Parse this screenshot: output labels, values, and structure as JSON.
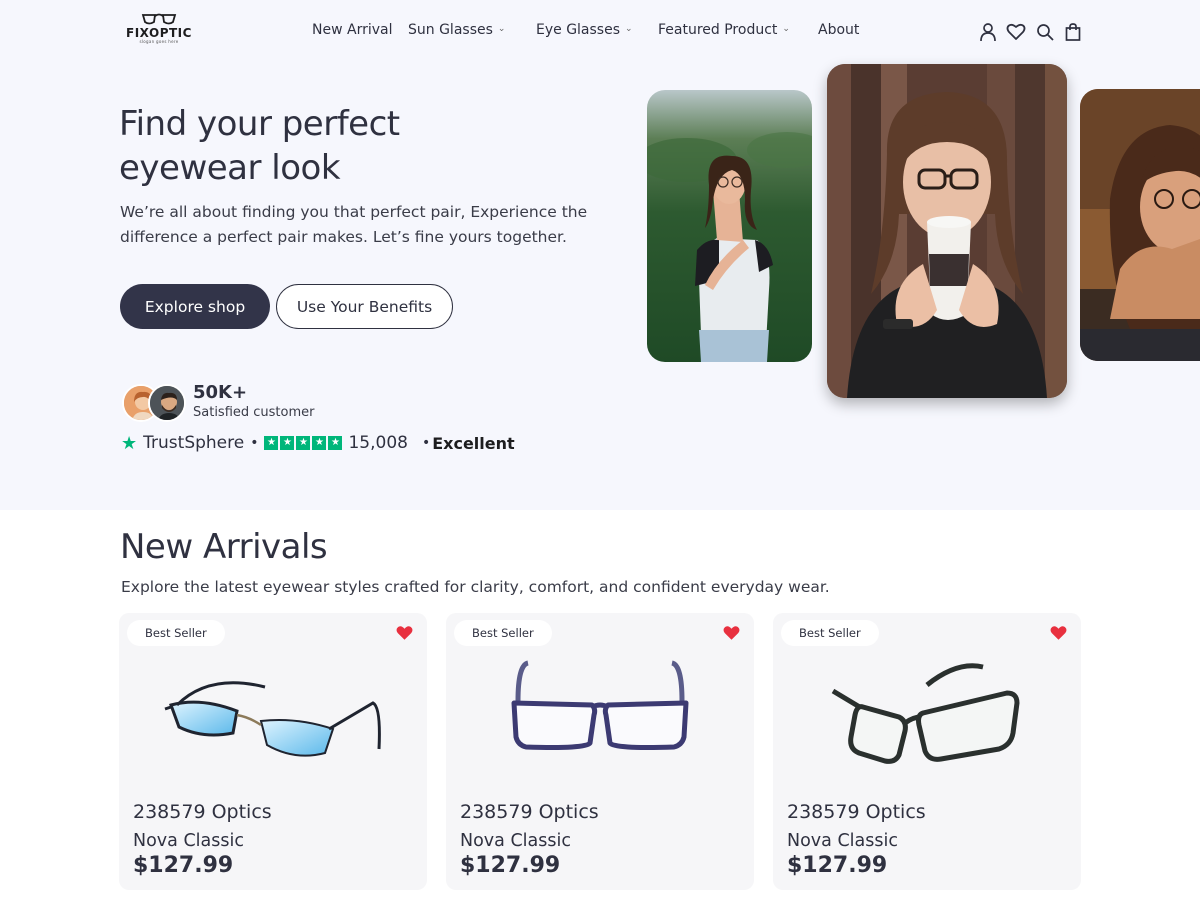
{
  "brand": {
    "name": "FIXOPTIC",
    "slogan": "slogan goes here"
  },
  "nav": {
    "items": [
      {
        "label": "New Arrival",
        "dropdown": false
      },
      {
        "label": "Sun Glasses",
        "dropdown": true
      },
      {
        "label": "Eye Glasses",
        "dropdown": true
      },
      {
        "label": "Featured Product",
        "dropdown": true
      },
      {
        "label": "About",
        "dropdown": false
      }
    ],
    "icons": [
      "user-icon",
      "heart-icon",
      "search-icon",
      "shopping-bag-icon"
    ]
  },
  "hero": {
    "title_line1": "Find your perfect",
    "title_line2": "eyewear look",
    "description": "We’re all about finding you that perfect pair, Experience the difference a perfect pair makes. Let’s fine yours together.",
    "primary_button": "Explore shop",
    "secondary_button": "Use Your Benefits",
    "stat_value": "50K+",
    "stat_label": "Satisfied customer",
    "trust": {
      "name": "TrustSphere",
      "stars": 5,
      "count": "15,008",
      "rating_label": "Excellent"
    }
  },
  "new_arrivals": {
    "title": "New Arrivals",
    "description": "Explore the latest eyewear styles crafted for clarity, comfort, and confident everyday wear.",
    "products": [
      {
        "badge": "Best Seller",
        "brand": "238579 Optics",
        "name": "Nova Classic",
        "price": "$127.99",
        "favorited": true
      },
      {
        "badge": "Best Seller",
        "brand": "238579 Optics",
        "name": "Nova Classic",
        "price": "$127.99",
        "favorited": true
      },
      {
        "badge": "Best Seller",
        "brand": "238579 Optics",
        "name": "Nova Classic",
        "price": "$127.99",
        "favorited": true
      }
    ]
  },
  "colors": {
    "primary": "#323449",
    "hero_background": "#f6f7fd",
    "trust_green": "#00b67a",
    "heart_red": "#e8303f",
    "card_background": "#f6f6f8"
  }
}
